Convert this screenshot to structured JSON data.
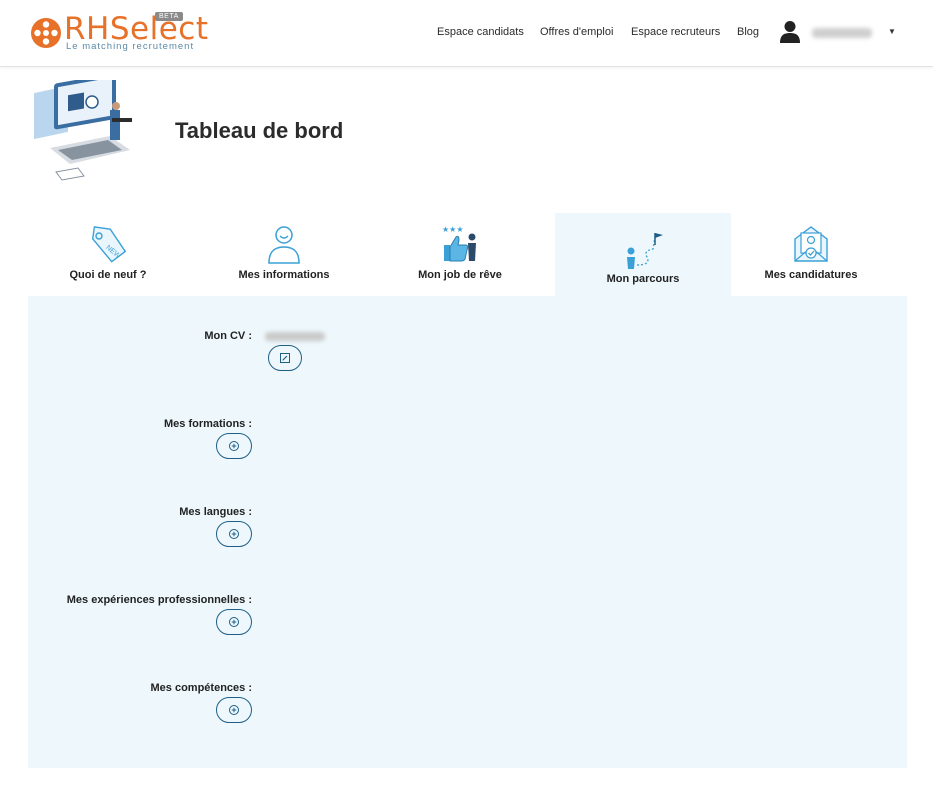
{
  "header": {
    "logo_text": "RHSelect",
    "logo_beta": "BETA",
    "logo_tagline": "Le matching recrutement",
    "nav": [
      "Espace candidats",
      "Offres d'emploi",
      "Espace recruteurs",
      "Blog"
    ]
  },
  "page": {
    "title": "Tableau de bord"
  },
  "tabs": [
    {
      "label": "Quoi de neuf ?",
      "icon": "new-tag-icon"
    },
    {
      "label": "Mes informations",
      "icon": "person-icon"
    },
    {
      "label": "Mon job de rêve",
      "icon": "thumbs-up-stars-icon"
    },
    {
      "label": "Mon parcours",
      "icon": "path-flag-icon",
      "active": true
    },
    {
      "label": "Mes candidatures",
      "icon": "envelope-check-icon"
    }
  ],
  "sections": {
    "cv": "Mon CV :",
    "formations": "Mes formations :",
    "langues": "Mes langues :",
    "experiences": "Mes expériences professionnelles :",
    "competences": "Mes compétences :"
  },
  "colors": {
    "brand_orange": "#e8712a",
    "accent_blue": "#1f5f86",
    "panel_bg": "#eef8fc"
  }
}
